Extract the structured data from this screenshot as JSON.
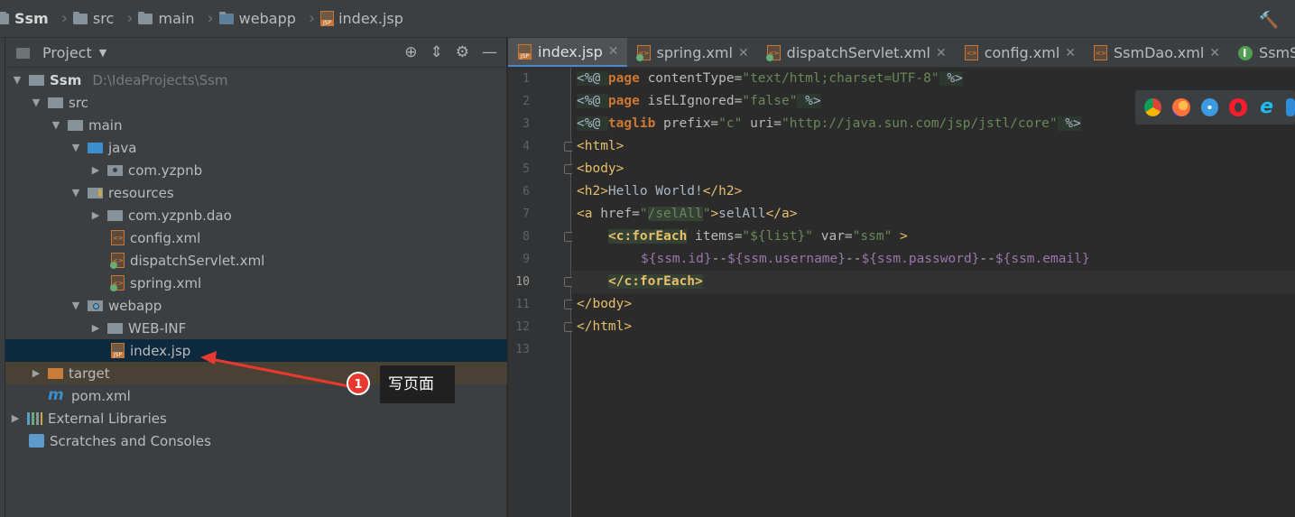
{
  "breadcrumb": [
    "Ssm",
    "src",
    "main",
    "webapp",
    "index.jsp"
  ],
  "project_panel": {
    "title": "Project",
    "tree": [
      {
        "label": "Ssm",
        "path": "D:\\IdeaProjects\\Ssm"
      },
      {
        "label": "src"
      },
      {
        "label": "main"
      },
      {
        "label": "java"
      },
      {
        "label": "com.yzpnb"
      },
      {
        "label": "resources"
      },
      {
        "label": "com.yzpnb.dao"
      },
      {
        "label": "config.xml"
      },
      {
        "label": "dispatchServlet.xml"
      },
      {
        "label": "spring.xml"
      },
      {
        "label": "webapp"
      },
      {
        "label": "WEB-INF"
      },
      {
        "label": "index.jsp"
      },
      {
        "label": "target"
      },
      {
        "label": "pom.xml"
      },
      {
        "label": "External Libraries"
      },
      {
        "label": "Scratches and Consoles"
      }
    ]
  },
  "annotation": {
    "number": "1",
    "text": "写页面"
  },
  "tabs": [
    "index.jsp",
    "spring.xml",
    "dispatchServlet.xml",
    "config.xml",
    "SsmDao.xml",
    "SsmService"
  ],
  "line_numbers": [
    "1",
    "2",
    "3",
    "4",
    "5",
    "6",
    "7",
    "8",
    "9",
    "10",
    "11",
    "12",
    "13"
  ],
  "current_line": "10",
  "code": {
    "l1": {
      "a": "<%@ ",
      "b": "page",
      "c": " contentType=",
      "d": "\"text/html;charset=UTF-8\"",
      "e": " %>"
    },
    "l2": {
      "a": "<%@ ",
      "b": "page",
      "c": " isELIgnored=",
      "d": "\"false\"",
      "e": " %>"
    },
    "l3": {
      "a": "<%@ ",
      "b": "taglib",
      "c": " prefix=",
      "d": "\"c\"",
      "e": " uri=",
      "f": "\"http://java.sun.com/jsp/jstl/core\"",
      "g": " %>"
    },
    "l4": "<html>",
    "l5": "<body>",
    "l6": {
      "a": "<h2>",
      "b": "Hello World!",
      "c": "</h2>"
    },
    "l7": {
      "a": "<a ",
      "b": "href=",
      "c": "\"",
      "d": "/selAll",
      "e": "\"",
      "f": ">",
      "g": "selAll",
      "h": "</a>"
    },
    "l8": {
      "a": "<c:forEach",
      "b": " items=",
      "c": "\"${list}\"",
      "d": " var=",
      "e": "\"ssm\"",
      "f": " >"
    },
    "l9": {
      "a": "${ssm.id}",
      "b": "--",
      "c": "${ssm.username}",
      "d": "--",
      "e": "${ssm.password}",
      "f": "--",
      "g": "${ssm.email}"
    },
    "l10": "</c:forEach>",
    "l11": "</body>",
    "l12": "</html>"
  },
  "browsers": [
    "chrome-icon",
    "firefox-icon",
    "safari-icon",
    "opera-icon",
    "ie-icon",
    "edge-icon"
  ],
  "colors": {
    "keyword": "#cc7832",
    "tag": "#e8bf6a",
    "string": "#6a8759",
    "selection": "#0d293e",
    "accent": "#4a88c7"
  }
}
